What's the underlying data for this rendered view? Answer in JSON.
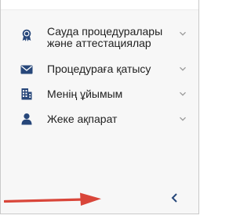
{
  "menu": {
    "items": [
      {
        "label": "Сауда процедуралары және аттестациялар",
        "icon": "award-medal-icon",
        "chevron": "chevron-down-icon"
      },
      {
        "label": "Процедураға қатысу",
        "icon": "envelope-icon",
        "chevron": "chevron-down-icon"
      },
      {
        "label": "Менің ұйымым",
        "icon": "building-icon",
        "chevron": "chevron-down-icon"
      },
      {
        "label": "Жеке ақпарат",
        "icon": "user-icon",
        "chevron": "chevron-down-icon"
      }
    ]
  },
  "collapse_control": {
    "icon": "chevron-left-icon"
  },
  "annotation": {
    "icon": "red-arrow-icon"
  },
  "colors": {
    "icon": "#27477a",
    "text": "#1f1f1f",
    "chevron": "#9a9a9a",
    "panel": "#f7f7f7",
    "arrow": "#d9463a"
  }
}
